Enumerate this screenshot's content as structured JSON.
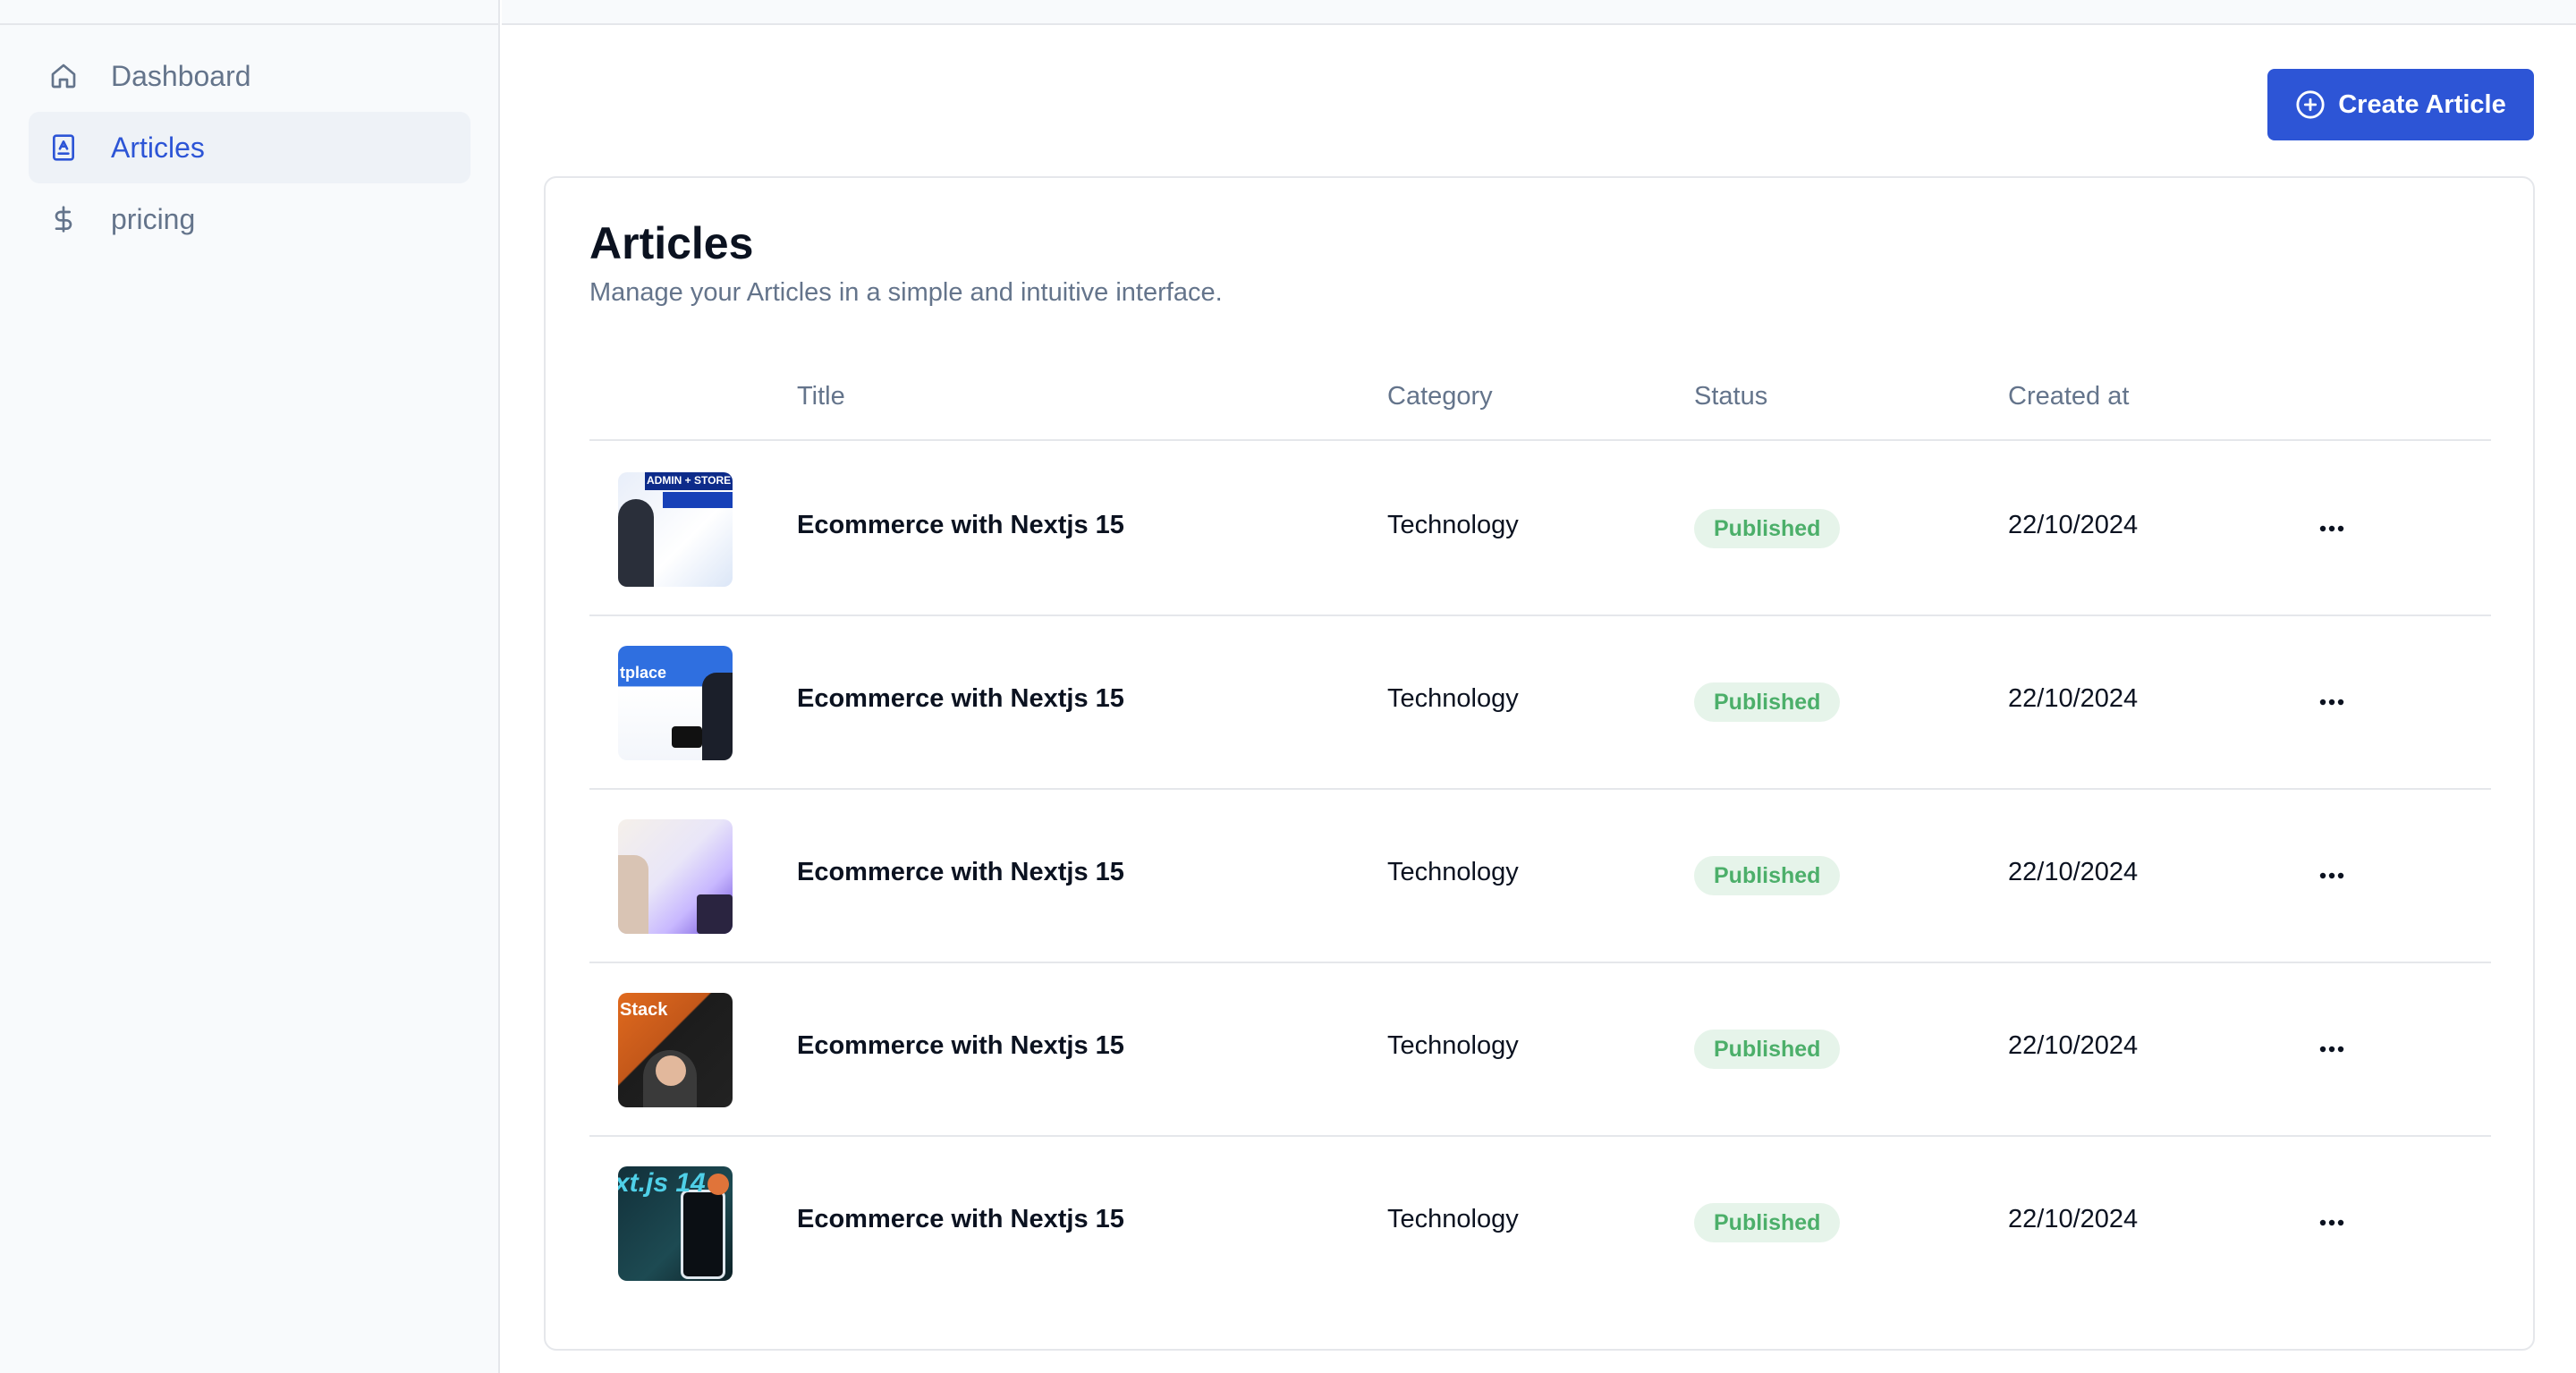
{
  "sidebar": {
    "items": [
      {
        "label": "Dashboard",
        "icon": "home-icon",
        "active": false
      },
      {
        "label": "Articles",
        "icon": "article-icon",
        "active": true
      },
      {
        "label": "pricing",
        "icon": "dollar-icon",
        "active": false
      }
    ]
  },
  "toolbar": {
    "create_label": "Create Article"
  },
  "main": {
    "title": "Articles",
    "subtitle": "Manage your Articles in a simple and intuitive interface.",
    "table": {
      "headers": [
        "Title",
        "Category",
        "Status",
        "Created at"
      ],
      "rows": [
        {
          "title": "Ecommerce with Nextjs 15",
          "category": "Technology",
          "status": "Published",
          "created_at": "22/10/2024",
          "thumb_text": "ADMIN + STORE"
        },
        {
          "title": "Ecommerce with Nextjs 15",
          "category": "Technology",
          "status": "Published",
          "created_at": "22/10/2024",
          "thumb_text": "tplace"
        },
        {
          "title": "Ecommerce with Nextjs 15",
          "category": "Technology",
          "status": "Published",
          "created_at": "22/10/2024",
          "thumb_text": ""
        },
        {
          "title": "Ecommerce with Nextjs 15",
          "category": "Technology",
          "status": "Published",
          "created_at": "22/10/2024",
          "thumb_text": "Stack"
        },
        {
          "title": "Ecommerce with Nextjs 15",
          "category": "Technology",
          "status": "Published",
          "created_at": "22/10/2024",
          "thumb_text": "xt.js 14"
        }
      ]
    }
  },
  "colors": {
    "accent": "#2d55d6",
    "badge_bg": "#e6f4ea",
    "badge_text": "#4caf6a"
  }
}
